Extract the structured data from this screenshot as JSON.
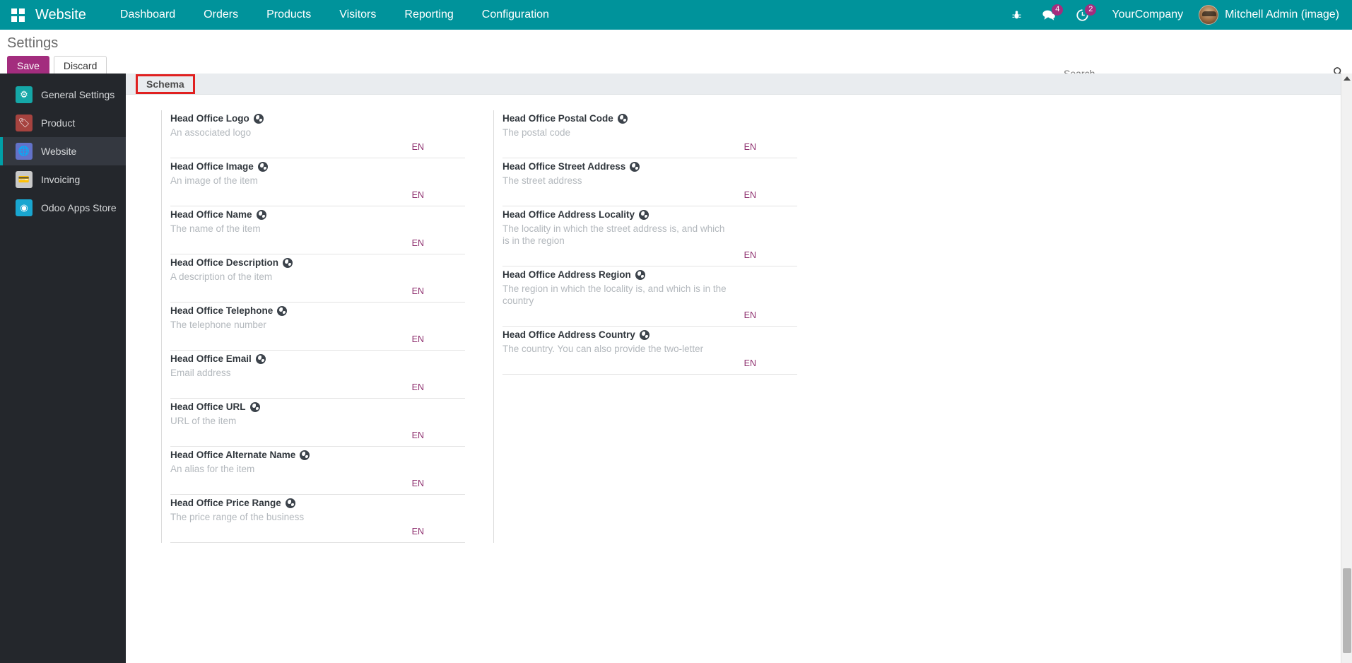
{
  "navbar": {
    "apps_icon": "apps-grid-icon",
    "brand": "Website",
    "menu": [
      "Dashboard",
      "Orders",
      "Products",
      "Visitors",
      "Reporting",
      "Configuration"
    ],
    "system_icons": [
      {
        "name": "bug-icon",
        "glyph": "⚙",
        "badge": null
      },
      {
        "name": "messages-icon",
        "glyph": "💬",
        "badge": "4"
      },
      {
        "name": "activity-clock-icon",
        "glyph": "◔",
        "badge": "2"
      }
    ],
    "company": "YourCompany",
    "user": "Mitchell Admin (image)",
    "accent_color": "#00939b",
    "badge_color": "#a32d7e"
  },
  "control_panel": {
    "title": "Settings",
    "save_label": "Save",
    "discard_label": "Discard",
    "search_placeholder": "Search...",
    "search_value": "",
    "search_icon": "search-icon"
  },
  "sidebar": {
    "items": [
      {
        "label": "General Settings",
        "icon": "gear-icon",
        "active": false
      },
      {
        "label": "Product",
        "icon": "tag-icon",
        "active": false
      },
      {
        "label": "Website",
        "icon": "globe-cursor-icon",
        "active": true
      },
      {
        "label": "Invoicing",
        "icon": "invoice-icon",
        "active": false
      },
      {
        "label": "Odoo Apps Store",
        "icon": "apps-store-icon",
        "active": false
      }
    ]
  },
  "main": {
    "section_tab": "Schema",
    "highlight_color": "#e02020",
    "left_fields": [
      {
        "label": "Head Office Logo",
        "help": "An associated logo",
        "lang": "EN"
      },
      {
        "label": "Head Office Image",
        "help": "An image of the item",
        "lang": "EN"
      },
      {
        "label": "Head Office Name",
        "help": "The name of the item",
        "lang": "EN"
      },
      {
        "label": "Head Office Description",
        "help": "A description of the item",
        "lang": "EN"
      },
      {
        "label": "Head Office Telephone",
        "help": "The telephone number",
        "lang": "EN"
      },
      {
        "label": "Head Office Email",
        "help": "Email address",
        "lang": "EN"
      },
      {
        "label": "Head Office URL",
        "help": "URL of the item",
        "lang": "EN"
      },
      {
        "label": "Head Office Alternate Name",
        "help": "An alias for the item",
        "lang": "EN"
      },
      {
        "label": "Head Office Price Range",
        "help": "The price range of the business",
        "lang": "EN"
      }
    ],
    "right_fields": [
      {
        "label": "Head Office Postal Code",
        "help": "The postal code",
        "lang": "EN"
      },
      {
        "label": "Head Office Street Address",
        "help": "The street address",
        "lang": "EN"
      },
      {
        "label": "Head Office Address Locality",
        "help": "The locality in which the street address is, and which is in the region",
        "lang": "EN"
      },
      {
        "label": "Head Office Address Region",
        "help": "The region in which the locality is, and which is in the country",
        "lang": "EN"
      },
      {
        "label": "Head Office Address Country",
        "help": "The country. You can also provide the two-letter",
        "lang": "EN"
      }
    ]
  }
}
